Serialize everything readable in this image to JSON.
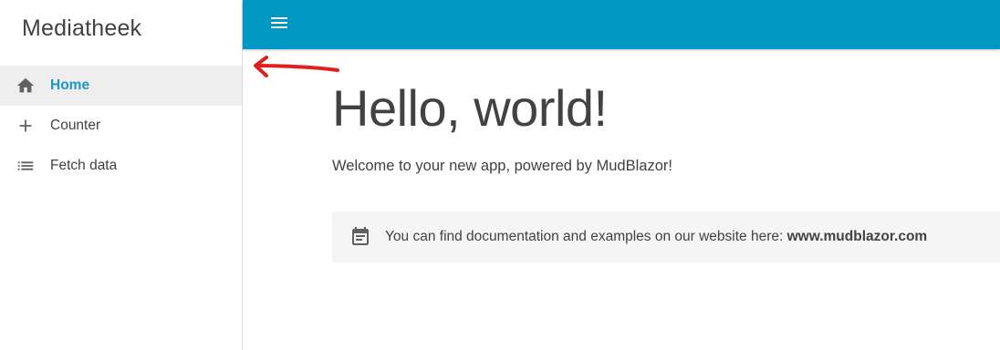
{
  "drawer": {
    "title": "Mediatheek",
    "items": [
      {
        "label": "Home",
        "icon": "home-icon",
        "active": true
      },
      {
        "label": "Counter",
        "icon": "add-icon",
        "active": false
      },
      {
        "label": "Fetch data",
        "icon": "list-icon",
        "active": false
      }
    ]
  },
  "appbar": {
    "menu_icon": "menu-icon"
  },
  "main": {
    "heading": "Hello, world!",
    "welcome": "Welcome to your new app, powered by MudBlazor!",
    "alert": {
      "icon": "event-note-icon",
      "text": "You can find documentation and examples on our website here: ",
      "link": "www.mudblazor.com"
    }
  },
  "colors": {
    "appbar": "#0097c4",
    "active_nav_text": "#1998c7",
    "active_nav_bg": "#eeeeee",
    "text": "#424242",
    "alert_bg": "#f5f5f5",
    "annotation": "#e02020"
  }
}
